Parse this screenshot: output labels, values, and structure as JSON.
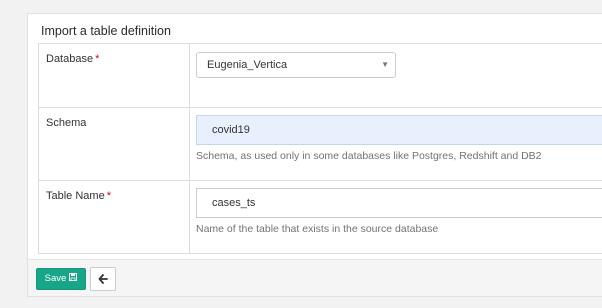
{
  "panel": {
    "title": "Import a table definition"
  },
  "form": {
    "database": {
      "label": "Database",
      "required_mark": "*",
      "value": "Eugenia_Vertica"
    },
    "schema": {
      "label": "Schema",
      "value": "covid19",
      "help": "Schema, as used only in some databases like Postgres, Redshift and DB2"
    },
    "table_name": {
      "label": "Table Name",
      "required_mark": "*",
      "value": "cases_ts",
      "help": "Name of the table that exists in the source database"
    }
  },
  "footer": {
    "save_label": "Save",
    "save_icon": "floppy-disk-icon",
    "back_icon": "arrow-left-icon"
  },
  "colors": {
    "primary": "#18a689",
    "required": "#d9001b",
    "focused_input": "#e8f0fe"
  }
}
